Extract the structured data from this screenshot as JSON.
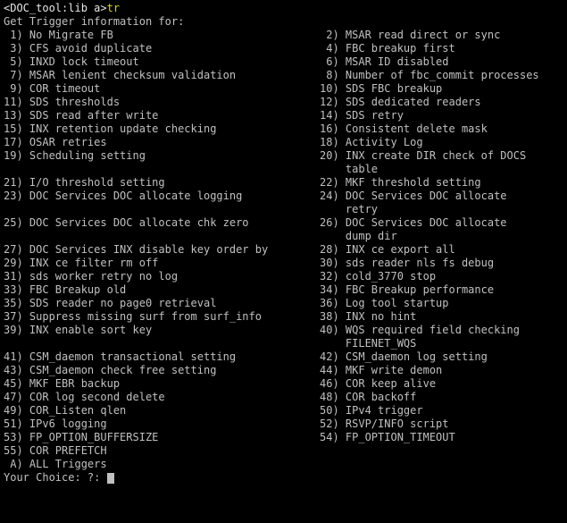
{
  "prompt": {
    "prefix": "<DOC_tool:lib a>",
    "command": "tr"
  },
  "header": "Get Trigger information for:",
  "choice": {
    "label": "Your Choice: ",
    "value": "?:"
  },
  "rows": [
    {
      "l": " 1) No Migrate FB",
      "r": " 2) MSAR read direct or sync"
    },
    {
      "l": " 3) CFS avoid duplicate",
      "r": " 4) FBC breakup first"
    },
    {
      "l": " 5) INXD lock timeout",
      "r": " 6) MSAR ID disabled"
    },
    {
      "l": " 7) MSAR lenient checksum validation",
      "r": " 8) Number of fbc_commit processes"
    },
    {
      "l": " 9) COR timeout",
      "r": "10) SDS FBC breakup"
    },
    {
      "l": "11) SDS thresholds",
      "r": "12) SDS dedicated readers"
    },
    {
      "l": "13) SDS read after write",
      "r": "14) SDS retry"
    },
    {
      "l": "15) INX retention update checking",
      "r": "16) Consistent delete mask"
    },
    {
      "l": "17) OSAR retries",
      "r": "18) Activity Log"
    },
    {
      "l": "19) Scheduling setting",
      "r": "20) INX create DIR check of DOCS"
    },
    {
      "l": "",
      "r": "    table"
    },
    {
      "l": "21) I/O threshold setting",
      "r": "22) MKF threshold setting"
    },
    {
      "l": "23) DOC Services DOC allocate logging",
      "r": "24) DOC Services DOC allocate"
    },
    {
      "l": "",
      "r": "    retry"
    },
    {
      "l": "25) DOC Services DOC allocate chk zero",
      "r": "26) DOC Services DOC allocate"
    },
    {
      "l": "",
      "r": "    dump dir"
    },
    {
      "l": "27) DOC Services INX disable key order by",
      "r": "28) INX ce export all"
    },
    {
      "l": "29) INX ce filter rm off",
      "r": "30) sds reader nls fs debug"
    },
    {
      "l": "31) sds worker retry no log",
      "r": "32) cold_3770 stop"
    },
    {
      "l": "33) FBC Breakup old",
      "r": "34) FBC Breakup performance"
    },
    {
      "l": "35) SDS reader no page0 retrieval",
      "r": "36) Log tool startup"
    },
    {
      "l": "37) Suppress missing surf from surf_info",
      "r": "38) INX no hint"
    },
    {
      "l": "39) INX enable sort key",
      "r": "40) WQS required field checking"
    },
    {
      "l": "",
      "r": "    FILENET_WQS"
    },
    {
      "l": "41) CSM_daemon transactional setting",
      "r": "42) CSM_daemon log setting"
    },
    {
      "l": "43) CSM_daemon check free setting",
      "r": "44) MKF write demon"
    },
    {
      "l": "45) MKF EBR backup",
      "r": "46) COR keep alive"
    },
    {
      "l": "47) COR log second delete",
      "r": "48) COR backoff"
    },
    {
      "l": "49) COR_Listen qlen",
      "r": "50) IPv4 trigger"
    },
    {
      "l": "51) IPv6 logging",
      "r": "52) RSVP/INFO script"
    },
    {
      "l": "53) FP_OPTION_BUFFERSIZE",
      "r": "54) FP_OPTION_TIMEOUT"
    },
    {
      "l": "55) COR PREFETCH",
      "r": ""
    },
    {
      "l": " A) ALL Triggers",
      "r": ""
    }
  ]
}
